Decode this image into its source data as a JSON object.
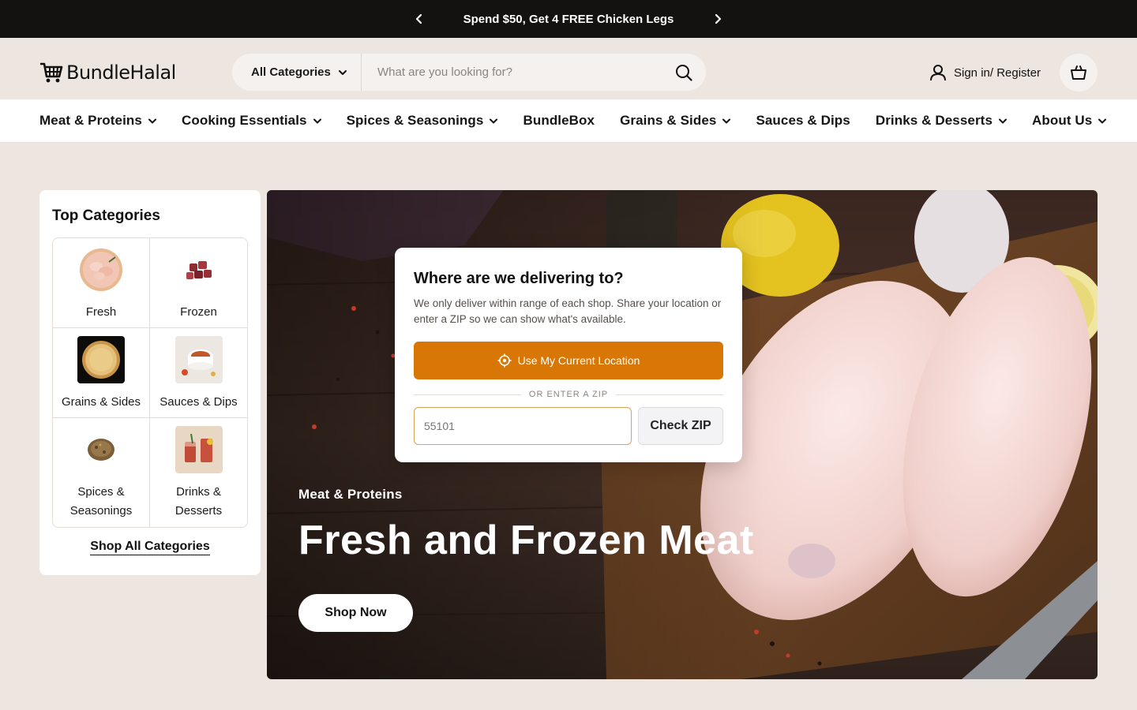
{
  "announcement": {
    "message": "Spend $50, Get 4 FREE Chicken Legs",
    "prev_icon": "chevron-left-icon",
    "next_icon": "chevron-right-icon"
  },
  "header": {
    "logo_text": "BundleHalal",
    "search": {
      "category_label": "All Categories",
      "placeholder": "What are you looking for?",
      "value": ""
    },
    "account_label": "Sign in/ Register"
  },
  "nav": {
    "items": [
      {
        "label": "Meat & Proteins",
        "dropdown": true
      },
      {
        "label": "Cooking Essentials",
        "dropdown": true
      },
      {
        "label": "Spices & Seasonings",
        "dropdown": true
      },
      {
        "label": "BundleBox",
        "dropdown": false
      },
      {
        "label": "Grains & Sides",
        "dropdown": true
      },
      {
        "label": "Sauces & Dips",
        "dropdown": false
      },
      {
        "label": "Drinks & Desserts",
        "dropdown": true
      },
      {
        "label": "About Us",
        "dropdown": true
      }
    ]
  },
  "top_categories": {
    "title": "Top Categories",
    "items": [
      {
        "label": "Fresh"
      },
      {
        "label": "Frozen"
      },
      {
        "label": "Grains & Sides"
      },
      {
        "label": "Sauces & Dips"
      },
      {
        "label": "Spices & Seasonings"
      },
      {
        "label": "Drinks & Desserts"
      }
    ],
    "shop_all": "Shop All Categories"
  },
  "hero": {
    "eyebrow": "Meat & Proteins",
    "title": "Fresh and Frozen Meat",
    "cta": "Shop Now"
  },
  "delivery_modal": {
    "title": "Where are we delivering to?",
    "description": "We only deliver within range of each shop. Share your location or enter a ZIP so we can show what's available.",
    "location_button": "Use My Current Location",
    "divider": "OR ENTER A ZIP",
    "zip_placeholder": "55101",
    "zip_value": "",
    "check_button": "Check ZIP"
  },
  "colors": {
    "announcement_bg": "#141210",
    "page_bg": "#ede6e0",
    "accent": "#d97706"
  }
}
